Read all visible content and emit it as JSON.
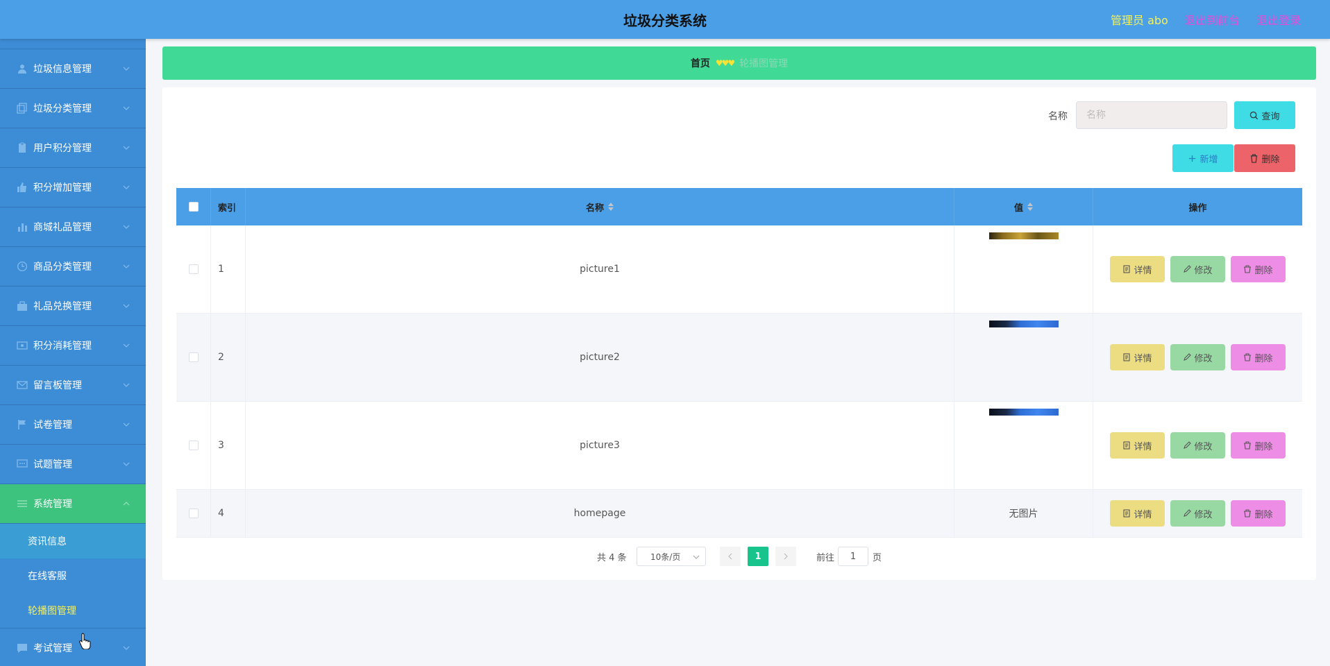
{
  "header": {
    "title": "垃圾分类系统",
    "admin": "管理员 abo",
    "front_link": "退出到前台",
    "logout_link": "退出登录"
  },
  "sidebar": {
    "items": [
      {
        "label": "垃圾信息管理",
        "icon": "user-icon"
      },
      {
        "label": "垃圾分类管理",
        "icon": "copy-icon"
      },
      {
        "label": "用户积分管理",
        "icon": "clipboard-icon"
      },
      {
        "label": "积分增加管理",
        "icon": "thumb-up-icon"
      },
      {
        "label": "商城礼品管理",
        "icon": "bar-chart-icon"
      },
      {
        "label": "商品分类管理",
        "icon": "clock-icon"
      },
      {
        "label": "礼品兑换管理",
        "icon": "briefcase-icon"
      },
      {
        "label": "积分消耗管理",
        "icon": "ticket-icon"
      },
      {
        "label": "留言板管理",
        "icon": "message-icon"
      },
      {
        "label": "试卷管理",
        "icon": "flag-icon"
      },
      {
        "label": "试题管理",
        "icon": "chat-icon"
      },
      {
        "label": "系统管理",
        "icon": "sliders-icon"
      }
    ],
    "sub_items": [
      {
        "label": "资讯信息"
      },
      {
        "label": "在线客服"
      },
      {
        "label": "轮播图管理"
      }
    ],
    "last_item": {
      "label": "考试管理",
      "icon": "chat-bubble-icon"
    }
  },
  "breadcrumb": {
    "home": "首页",
    "current": "轮播图管理"
  },
  "search": {
    "label": "名称",
    "placeholder": "名称",
    "query_button": "查询"
  },
  "toolbar": {
    "add_button": "新增",
    "delete_button": "删除"
  },
  "table": {
    "headers": {
      "index": "索引",
      "name": "名称",
      "value": "值",
      "action": "操作"
    },
    "rows": [
      {
        "index": "1",
        "name": "picture1",
        "value": ""
      },
      {
        "index": "2",
        "name": "picture2",
        "value": ""
      },
      {
        "index": "3",
        "name": "picture3",
        "value": ""
      },
      {
        "index": "4",
        "name": "homepage",
        "value": "无图片"
      }
    ],
    "actions": {
      "detail": "详情",
      "edit": "修改",
      "remove": "删除"
    }
  },
  "pagination": {
    "total": "共 4 条",
    "page_size": "10条/页",
    "current_page": "1",
    "goto_label": "前往",
    "goto_value": "1",
    "page_suffix": "页"
  },
  "colors": {
    "header": "#4a9fe6",
    "sidebar": "#3d8cd6",
    "sidebar_active": "#3ec37f",
    "breadcrumb": "#40d996",
    "accent_yellow": "#f7f15a",
    "accent_pink": "#e94bd8"
  }
}
